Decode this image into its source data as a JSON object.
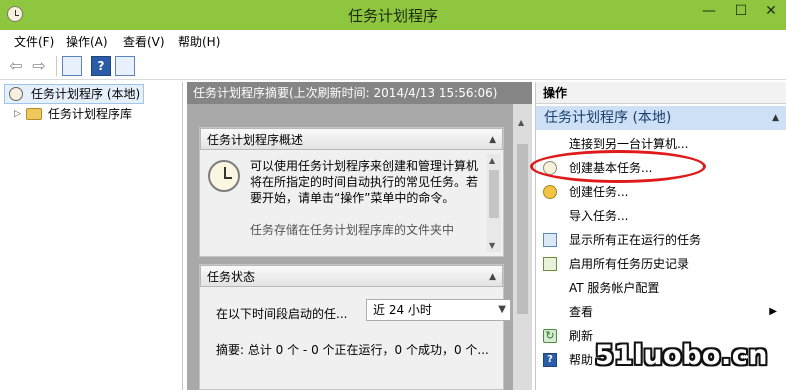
{
  "window": {
    "title": "任务计划程序",
    "controls": {
      "minimize": "—",
      "maximize": "☐",
      "close": "✕"
    }
  },
  "menubar": {
    "items": [
      "文件(F)",
      "操作(A)",
      "查看(V)",
      "帮助(H)"
    ]
  },
  "toolbar": {
    "back_glyph": "⇦",
    "forward_glyph": "⇨",
    "help_glyph": "?"
  },
  "tree": {
    "root": "任务计划程序 (本地)",
    "child": "任务计划程序库",
    "expander_glyph": "▷"
  },
  "center": {
    "header": "任务计划程序摘要(上次刷新时间: 2014/4/13 15:56:06)",
    "overview": {
      "title": "任务计划程序概述",
      "text": "可以使用任务计划程序来创建和管理计算机将在所指定的时间自动执行的常见任务。若要开始，请单击“操作”菜单中的命令。",
      "more": "任务存储在任务计划程序库的文件夹中"
    },
    "status": {
      "title": "任务状态",
      "filter_label": "在以下时间段启动的任...",
      "filter_value": "近 24 小时",
      "summary": "摘要: 总计 0 个 - 0 个正在运行，0 个成功，0 个..."
    }
  },
  "actions": {
    "title": "操作",
    "group": "任务计划程序 (本地)",
    "items": [
      {
        "label": "连接到另一台计算机...",
        "icon": "none"
      },
      {
        "label": "创建基本任务...",
        "icon": "basic-task-icon"
      },
      {
        "label": "创建任务...",
        "icon": "create-task-icon"
      },
      {
        "label": "导入任务...",
        "icon": "none"
      },
      {
        "label": "显示所有正在运行的任务",
        "icon": "running-tasks-icon"
      },
      {
        "label": "启用所有任务历史记录",
        "icon": "history-icon"
      },
      {
        "label": "AT 服务帐户配置",
        "icon": "none"
      },
      {
        "label": "查看",
        "icon": "none"
      },
      {
        "label": "刷新",
        "icon": "refresh-icon"
      },
      {
        "label": "帮助",
        "icon": "help-icon"
      }
    ],
    "submenu_glyph": "▶"
  },
  "watermark": "51luobo.cn",
  "colors": {
    "titlebar": "#8ec73f",
    "highlight": "#e01a1a",
    "actions_group": "#cde0f5"
  }
}
